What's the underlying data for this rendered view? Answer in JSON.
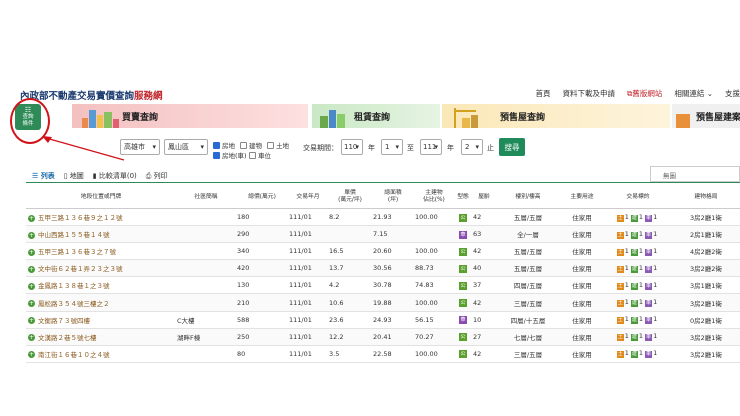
{
  "header": {
    "logo_org": "內政部",
    "logo_title": "不動產交易實價查詢",
    "logo_suffix": "服務網",
    "nav": [
      "首頁",
      "資料下載及申請",
      "舊版網站",
      "相關連結 ⌄",
      "支援"
    ]
  },
  "left_icon": {
    "label1": "查詢",
    "label2": "條件"
  },
  "tabs": [
    "買賣查詢",
    "租賃查詢",
    "預售屋查詢",
    "預售屋建案"
  ],
  "search": {
    "city": "高雄市",
    "district": "鳳山區",
    "cb_house": "房地",
    "cb_building": "建物",
    "cb_land": "土地",
    "cb_house_park": "房地(車)",
    "cb_park": "車位",
    "period_label": "交易期間：",
    "from_year": "110",
    "year_label": "年",
    "from_month": "1",
    "to_label": "至",
    "to_year": "111",
    "to_year_label": "年",
    "to_month": "2",
    "end_label": "止",
    "search_button": "搜尋"
  },
  "view_tabs": [
    "列表",
    "地圖",
    "比較清單(0)",
    "列印"
  ],
  "no_button": "無圖",
  "table": {
    "headers": [
      "地段位置或門牌",
      "社區簡稱",
      "總價(萬元)",
      "交易年月",
      "單價\n(萬元/坪)",
      "總面積\n(坪)",
      "主建物\n佔比(%)",
      "型態",
      "屋齡",
      "樓別/樓高",
      "主要用途",
      "交易標的",
      "建物格局"
    ],
    "rows": [
      [
        "五甲三路１３６巷９之１２號",
        "",
        "180",
        "111/01",
        "8.2",
        "21.93",
        "100.00",
        "",
        "42",
        "五層/五層",
        "住家用",
        "",
        "3房2廳1衛"
      ],
      [
        "中山西路１５５巷１４號",
        "",
        "290",
        "111/01",
        "",
        "7.15",
        "",
        "",
        "63",
        "全/一層",
        "住家用",
        "",
        "2房1廳1衛"
      ],
      [
        "五甲三路１３６巷３之７號",
        "",
        "340",
        "111/01",
        "16.5",
        "20.60",
        "100.00",
        "",
        "42",
        "五層/五層",
        "住家用",
        "",
        "4房2廳2衛"
      ],
      [
        "文中街６２巷１弄２３之３號",
        "",
        "420",
        "111/01",
        "13.7",
        "30.56",
        "88.73",
        "",
        "40",
        "五層/五層",
        "住家用",
        "",
        "3房2廳2衛"
      ],
      [
        "金鳳路１３８巷１之３號",
        "",
        "130",
        "111/01",
        "4.2",
        "30.78",
        "74.83",
        "",
        "37",
        "四層/五層",
        "住家用",
        "",
        "3房1廳1衛"
      ],
      [
        "鳳松路３５４號三樓之２",
        "",
        "210",
        "111/01",
        "10.6",
        "19.88",
        "100.00",
        "",
        "42",
        "三層/五層",
        "住家用",
        "",
        "3房2廳1衛"
      ],
      [
        "文衡路７３號四樓",
        "C大樓",
        "588",
        "111/01",
        "23.6",
        "24.93",
        "56.15",
        "",
        "10",
        "四層/十五層",
        "住家用",
        "",
        "0房2廳1衛"
      ],
      [
        "文漢路２巷５號七樓",
        "湖畔F棟",
        "250",
        "111/01",
        "12.2",
        "20.41",
        "70.27",
        "",
        "27",
        "七層/七層",
        "住家用",
        "",
        "3房2廳1衛"
      ],
      [
        "南江街１６巷１０之４號",
        "",
        "80",
        "111/01",
        "3.5",
        "22.58",
        "100.00",
        "",
        "42",
        "三層/五層",
        "住家用",
        "",
        "3房2廳1衛"
      ]
    ],
    "type_badges": [
      "公",
      "華",
      "公",
      "公",
      "公",
      "公",
      "華",
      "公",
      "公"
    ],
    "target_marks": [
      "土",
      "建",
      "車"
    ]
  },
  "colors": {
    "accent": "#1f8a5a",
    "annotation": "#d0141a",
    "brand_red": "#c1272d"
  }
}
